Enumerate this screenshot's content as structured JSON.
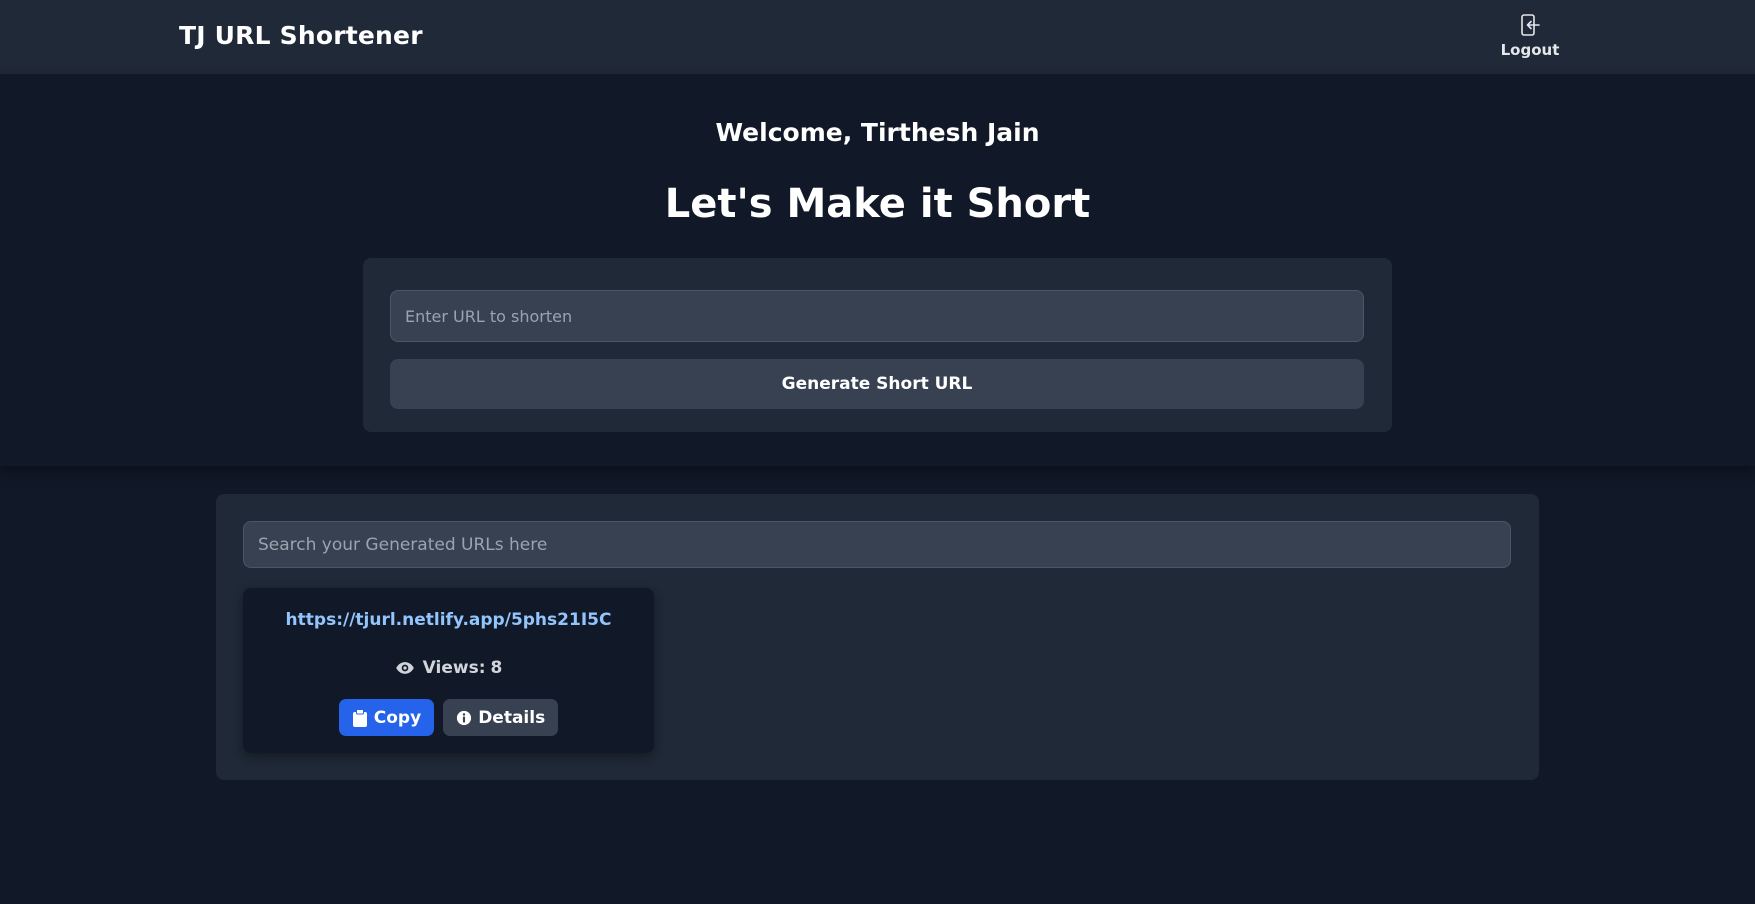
{
  "header": {
    "brand": "TJ URL Shortener",
    "logout_label": "Logout",
    "logout_icon": "logout-icon"
  },
  "hero": {
    "welcome": "Welcome, Tirthesh Jain",
    "title": "Let's Make it Short",
    "url_input": {
      "value": "",
      "placeholder": "Enter URL to shorten"
    },
    "generate_label": "Generate Short URL"
  },
  "urls": {
    "search": {
      "value": "",
      "placeholder": "Search your Generated URLs here"
    },
    "items": [
      {
        "short_url": "https://tjurl.netlify.app/5phs21I5C",
        "views_label": "Views:",
        "views": 8,
        "views_icon": "eye-icon",
        "copy_label": "Copy",
        "copy_icon": "clipboard-icon",
        "details_label": "Details",
        "details_icon": "info-icon"
      }
    ]
  },
  "colors": {
    "page_bg": "#111827",
    "panel_bg": "#1f2937",
    "input_bg": "#374151",
    "link": "#93c5fd",
    "primary": "#2563eb"
  }
}
